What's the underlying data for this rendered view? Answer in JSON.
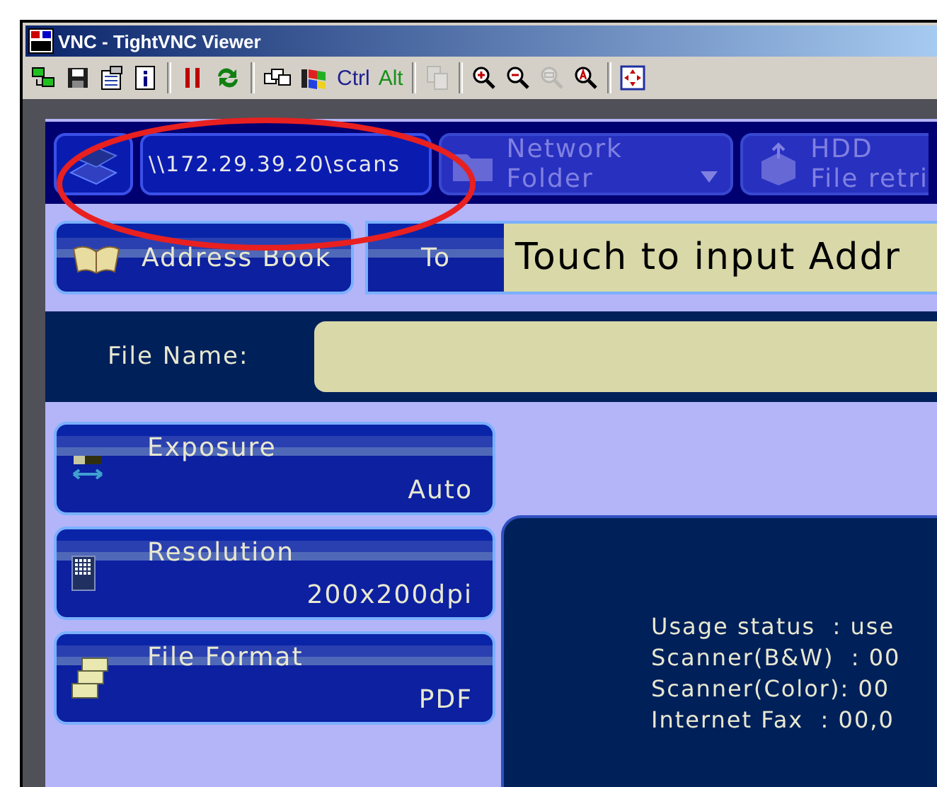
{
  "window": {
    "title": "VNC - TightVNC Viewer"
  },
  "toolbar": [
    {
      "kind": "icon",
      "disabled": false
    },
    {
      "kind": "icon",
      "disabled": false
    },
    {
      "kind": "icon",
      "disabled": false
    },
    {
      "kind": "icon",
      "disabled": false
    },
    {
      "kind": "separator"
    },
    {
      "kind": "icon",
      "disabled": false
    },
    {
      "kind": "icon",
      "disabled": false
    },
    {
      "kind": "separator"
    },
    {
      "kind": "icon",
      "disabled": false
    },
    {
      "kind": "icon",
      "disabled": false
    },
    {
      "kind": "text",
      "label": "Ctrl",
      "color": "#202090"
    },
    {
      "kind": "text",
      "label": "Alt",
      "color": "#189018"
    },
    {
      "kind": "separator"
    },
    {
      "kind": "icon",
      "disabled": true
    },
    {
      "kind": "separator"
    },
    {
      "kind": "icon",
      "disabled": false
    },
    {
      "kind": "icon",
      "disabled": false
    },
    {
      "kind": "icon",
      "disabled": true
    },
    {
      "kind": "icon",
      "disabled": false
    },
    {
      "kind": "separator"
    },
    {
      "kind": "icon",
      "disabled": false
    }
  ],
  "mode_tabs": [
    {
      "kind": "icon",
      "disabled": false
    },
    {
      "kind": "path",
      "label": "\\\\172.29.39.20\\scans",
      "disabled": false
    },
    {
      "kind": "dropdown",
      "lines": [
        "Network",
        "Folder"
      ],
      "disabled": true
    },
    {
      "kind": "storage",
      "lines": [
        "HDD",
        "File retri"
      ],
      "disabled": true
    }
  ],
  "annotation": {
    "kind": "ellipse",
    "color": "#e82020"
  },
  "address_row": {
    "address_book": "Address Book",
    "to_label": "To",
    "address_field": {
      "placeholder": "Touch to input Addr"
    }
  },
  "file_name": {
    "label": "File Name:"
  },
  "settings": [
    {
      "label": "Exposure",
      "value": "Auto"
    },
    {
      "label": "Resolution",
      "value": "200x200dpi"
    },
    {
      "label": "File Format",
      "value": "PDF"
    }
  ],
  "status_panel": {
    "lines": [
      "Usage status  : use",
      "Scanner(B&W)  : 00",
      "Scanner(Color): 00",
      "Internet Fax  : 00,0"
    ]
  }
}
